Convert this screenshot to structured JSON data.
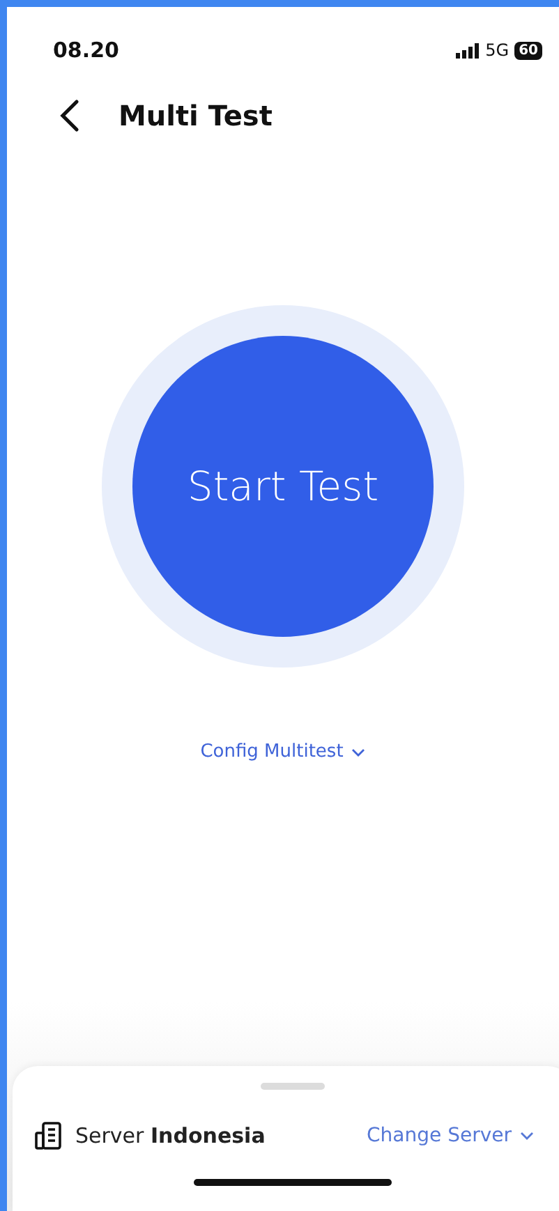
{
  "status_bar": {
    "time": "08.20",
    "network": "5G",
    "battery": "60"
  },
  "header": {
    "title": "Multi Test"
  },
  "start_button": {
    "label": "Start Test"
  },
  "config": {
    "label": "Config Multitest"
  },
  "server_sheet": {
    "server": "Server **Indonesia**",
    "change_label": "Change Server"
  }
}
